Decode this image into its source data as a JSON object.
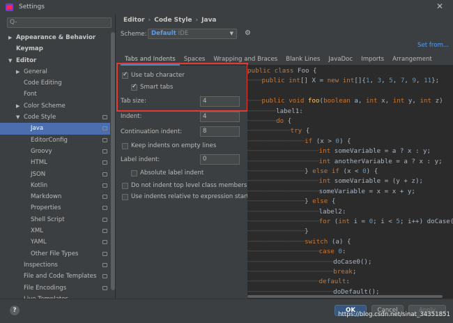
{
  "window": {
    "title": "Settings",
    "close_icon": "close-icon"
  },
  "sidebar": {
    "search_placeholder": "Q-",
    "items": [
      {
        "label": "Appearance & Behavior",
        "arrow": "▶",
        "bold": true
      },
      {
        "label": "Keymap",
        "bold": true
      },
      {
        "label": "Editor",
        "arrow": "▼",
        "bold": true
      },
      {
        "label": "General",
        "arrow": "▶"
      },
      {
        "label": "Code Editing"
      },
      {
        "label": "Font"
      },
      {
        "label": "Color Scheme",
        "arrow": "▶"
      },
      {
        "label": "Code Style",
        "arrow": "▼",
        "cfg": true
      },
      {
        "label": "Java",
        "selected": true,
        "cfg": true
      },
      {
        "label": "EditorConfig",
        "cfg": true
      },
      {
        "label": "Groovy",
        "cfg": true
      },
      {
        "label": "HTML",
        "cfg": true
      },
      {
        "label": "JSON",
        "cfg": true
      },
      {
        "label": "Kotlin",
        "cfg": true
      },
      {
        "label": "Markdown",
        "cfg": true
      },
      {
        "label": "Properties",
        "cfg": true
      },
      {
        "label": "Shell Script",
        "cfg": true
      },
      {
        "label": "XML",
        "cfg": true
      },
      {
        "label": "YAML",
        "cfg": true
      },
      {
        "label": "Other File Types",
        "cfg": true
      },
      {
        "label": "Inspections",
        "cfg": true
      },
      {
        "label": "File and Code Templates",
        "cfg": true
      },
      {
        "label": "File Encodings",
        "cfg": true
      },
      {
        "label": "Live Templates"
      }
    ]
  },
  "header": {
    "breadcrumb": [
      "Editor",
      "Code Style",
      "Java"
    ],
    "breadcrumb_sep": "›",
    "scheme_label": "Scheme:",
    "scheme_name": "Default",
    "scheme_sub": "IDE",
    "set_from": "Set from..."
  },
  "tabs": [
    "Tabs and Indents",
    "Spaces",
    "Wrapping and Braces",
    "Blank Lines",
    "JavaDoc",
    "Imports",
    "Arrangement"
  ],
  "options": {
    "use_tab_character": "Use tab character",
    "smart_tabs": "Smart tabs",
    "tab_size_label": "Tab size:",
    "tab_size_value": "4",
    "indent_label": "Indent:",
    "indent_value": "4",
    "continuation_label": "Continuation indent:",
    "continuation_value": "8",
    "keep_indents": "Keep indents on empty lines",
    "label_indent_label": "Label indent:",
    "label_indent_value": "0",
    "absolute_label": "Absolute label indent",
    "no_indent_top": "Do not indent top level class members",
    "use_relative": "Use indents relative to expression start"
  },
  "code_lines": [
    {
      "i": "",
      "parts": [
        [
          "k",
          "public class "
        ],
        [
          "t",
          "Foo {"
        ]
      ]
    },
    {
      "i": "────",
      "parts": [
        [
          "k",
          "public int"
        ],
        [
          "t",
          "[] X = "
        ],
        [
          "k",
          "new int"
        ],
        [
          "t",
          "[]{"
        ],
        [
          "n",
          "1"
        ],
        [
          "t",
          ", "
        ],
        [
          "n",
          "3"
        ],
        [
          "t",
          ", "
        ],
        [
          "n",
          "5"
        ],
        [
          "t",
          ", "
        ],
        [
          "n",
          "7"
        ],
        [
          "t",
          ", "
        ],
        [
          "n",
          "9"
        ],
        [
          "t",
          ", "
        ],
        [
          "n",
          "11"
        ],
        [
          "t",
          "};"
        ]
      ]
    },
    {
      "i": "",
      "parts": []
    },
    {
      "i": "────",
      "parts": [
        [
          "k",
          "public void "
        ],
        [
          "f",
          "foo"
        ],
        [
          "t",
          "("
        ],
        [
          "k",
          "boolean "
        ],
        [
          "t",
          "a, "
        ],
        [
          "k",
          "int "
        ],
        [
          "t",
          "x, "
        ],
        [
          "k",
          "int "
        ],
        [
          "t",
          "y, "
        ],
        [
          "k",
          "int "
        ],
        [
          "t",
          "z)"
        ]
      ]
    },
    {
      "i": "────────",
      "parts": [
        [
          "l",
          "label1:"
        ]
      ]
    },
    {
      "i": "────────",
      "parts": [
        [
          "k",
          "do "
        ],
        [
          "t",
          "{"
        ]
      ]
    },
    {
      "i": "────────────",
      "parts": [
        [
          "k",
          "try "
        ],
        [
          "t",
          "{"
        ]
      ]
    },
    {
      "i": "────────────────",
      "parts": [
        [
          "k",
          "if "
        ],
        [
          "t",
          "(x > "
        ],
        [
          "n",
          "0"
        ],
        [
          "t",
          ") {"
        ]
      ]
    },
    {
      "i": "────────────────────",
      "parts": [
        [
          "k",
          "int "
        ],
        [
          "t",
          "someVariable = a ? x : y;"
        ]
      ]
    },
    {
      "i": "────────────────────",
      "parts": [
        [
          "k",
          "int "
        ],
        [
          "t",
          "anotherVariable = a ? x : y;"
        ]
      ]
    },
    {
      "i": "────────────────",
      "parts": [
        [
          "t",
          "} "
        ],
        [
          "k",
          "else if "
        ],
        [
          "t",
          "(x < "
        ],
        [
          "n",
          "0"
        ],
        [
          "t",
          ") {"
        ]
      ]
    },
    {
      "i": "────────────────────",
      "parts": [
        [
          "k",
          "int "
        ],
        [
          "t",
          "someVariable = (y + z);"
        ]
      ]
    },
    {
      "i": "────────────────────",
      "parts": [
        [
          "t",
          "someVariable = x = x + y;"
        ]
      ]
    },
    {
      "i": "────────────────",
      "parts": [
        [
          "t",
          "} "
        ],
        [
          "k",
          "else "
        ],
        [
          "t",
          "{"
        ]
      ]
    },
    {
      "i": "────────────────────",
      "parts": [
        [
          "l",
          "label2:"
        ]
      ]
    },
    {
      "i": "────────────────────",
      "parts": [
        [
          "k",
          "for "
        ],
        [
          "t",
          "("
        ],
        [
          "k",
          "int "
        ],
        [
          "t",
          "i = "
        ],
        [
          "n",
          "0"
        ],
        [
          "t",
          "; i < "
        ],
        [
          "n",
          "5"
        ],
        [
          "t",
          "; i++) doCase("
        ]
      ]
    },
    {
      "i": "────────────────",
      "parts": [
        [
          "t",
          "}"
        ]
      ]
    },
    {
      "i": "────────────────",
      "parts": [
        [
          "k",
          "switch "
        ],
        [
          "t",
          "(a) {"
        ]
      ]
    },
    {
      "i": "────────────────────",
      "parts": [
        [
          "k",
          "case "
        ],
        [
          "n",
          "0"
        ],
        [
          "t",
          ":"
        ]
      ]
    },
    {
      "i": "────────────────────────",
      "parts": [
        [
          "t",
          "doCase0();"
        ]
      ]
    },
    {
      "i": "────────────────────────",
      "parts": [
        [
          "k",
          "break"
        ],
        [
          "t",
          ";"
        ]
      ]
    },
    {
      "i": "────────────────────",
      "parts": [
        [
          "k",
          "default"
        ],
        [
          "t",
          ":"
        ]
      ]
    },
    {
      "i": "────────────────────────",
      "parts": [
        [
          "t",
          "doDefault();"
        ]
      ]
    }
  ],
  "buttons": {
    "ok": "OK",
    "cancel": "Cancel",
    "apply": "Apply",
    "help": "?"
  },
  "watermark": "https://blog.csdn.net/sinat_34351851"
}
